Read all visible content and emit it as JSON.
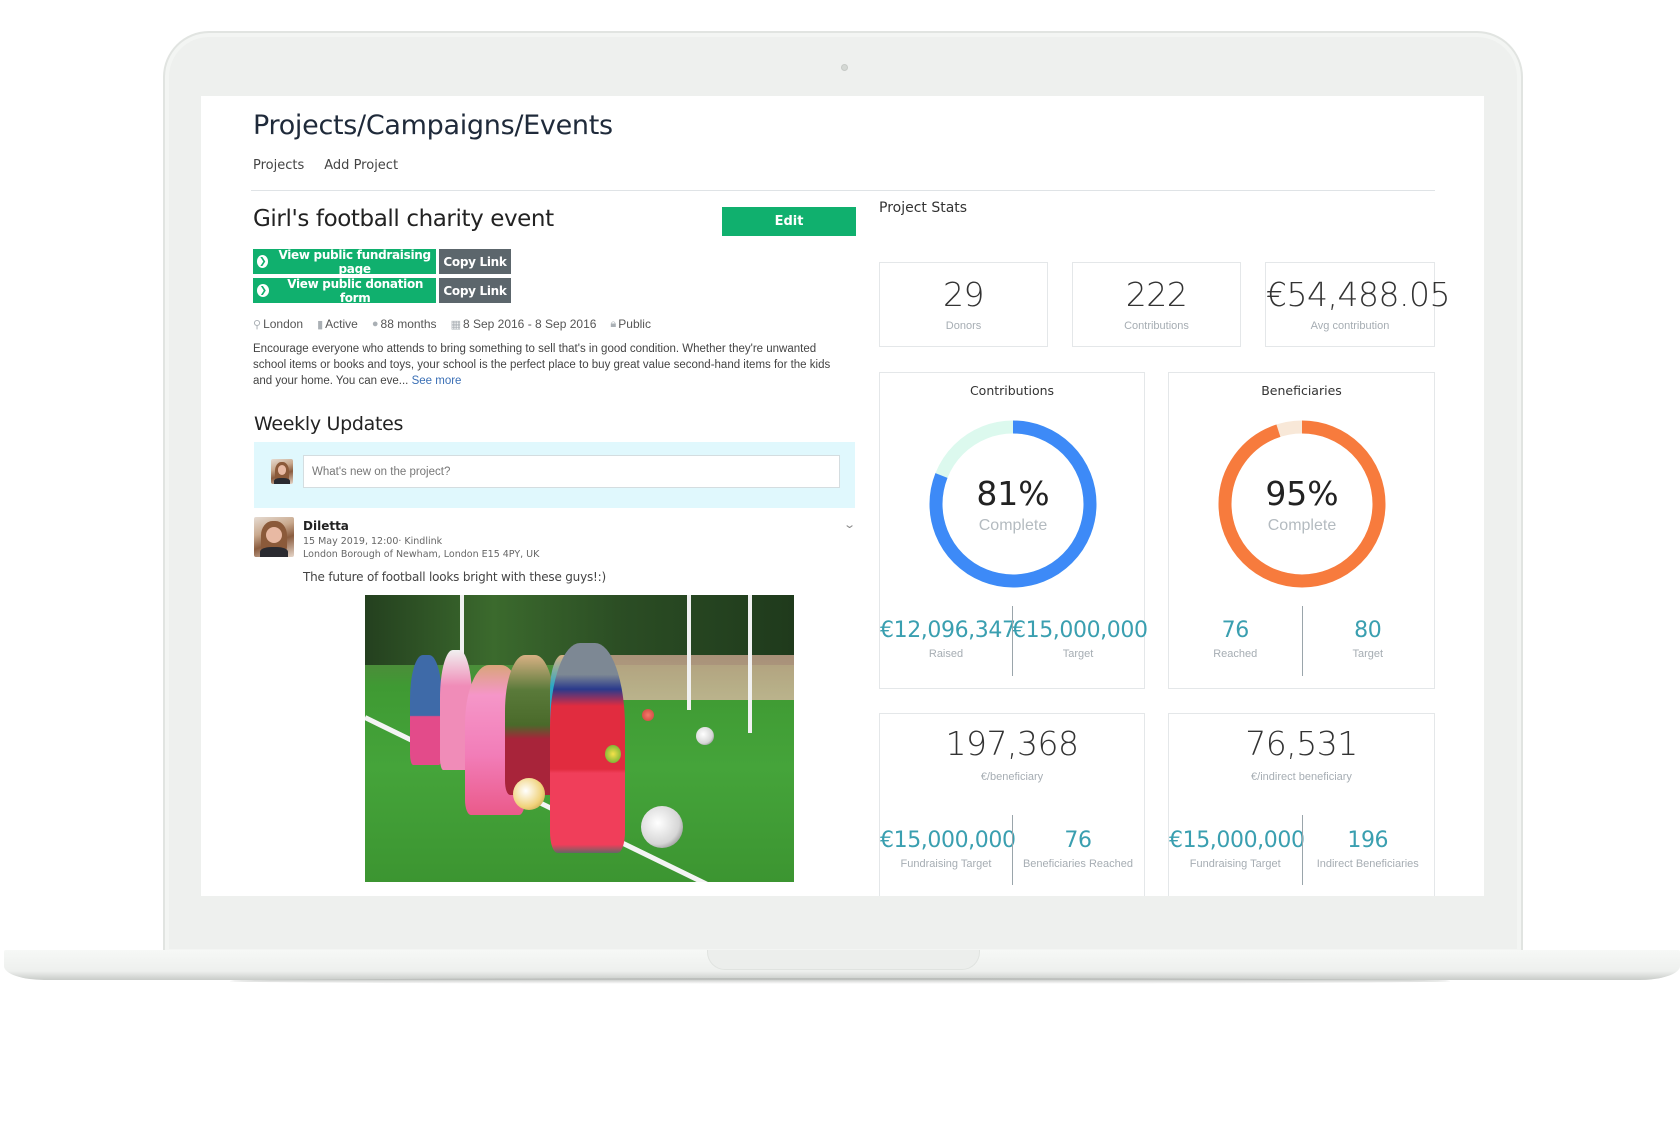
{
  "header": {
    "title": "Projects/Campaigns/Events",
    "nav": [
      {
        "label": "Projects"
      },
      {
        "label": "Add Project"
      }
    ]
  },
  "project": {
    "title": "Girl's football charity event",
    "edit_label": "Edit",
    "links": [
      {
        "label": "View public fundraising page",
        "copy_label": "Copy Link"
      },
      {
        "label": "View public donation form",
        "copy_label": "Copy Link"
      }
    ],
    "meta": {
      "location": "London",
      "status": "Active",
      "duration": "88 months",
      "dates": "8 Sep 2016 - 8 Sep 2016",
      "visibility": "Public"
    },
    "description": "Encourage everyone who attends to bring something to sell that's in good condition. Whether they're unwanted school items or books and toys, your school is the perfect place to buy great value second-hand items for the kids and your home. You can eve...",
    "see_more": "See more"
  },
  "updates": {
    "title": "Weekly Updates",
    "composer_placeholder": "What's new on the project?",
    "posts": [
      {
        "author": "Diletta",
        "timestamp": "15 May 2019, 12:00· Kindlink",
        "location": "London Borough of Newham, London E15 4PY, UK",
        "text": "The future of football looks bright with these guys!:)",
        "image_alt": "Children playing football on a green pitch"
      }
    ]
  },
  "stats": {
    "title": "Project Stats",
    "summary": [
      {
        "value": "29",
        "label": "Donors"
      },
      {
        "value": "222",
        "label": "Contributions"
      },
      {
        "value": "€54,488.05",
        "label": "Avg contribution"
      }
    ],
    "contributions": {
      "title": "Contributions",
      "percent": 81,
      "percent_label": "81%",
      "complete_label": "Complete",
      "color": "#3d8af7",
      "track_color": "#dcf9ee",
      "left": {
        "value": "€12,096,347",
        "label": "Raised"
      },
      "right": {
        "value": "€15,000,000",
        "label": "Target"
      }
    },
    "beneficiaries": {
      "title": "Beneficiaries",
      "percent": 95,
      "percent_label": "95%",
      "complete_label": "Complete",
      "color": "#f77b3d",
      "track_color": "#f8e8d8",
      "left": {
        "value": "76",
        "label": "Reached"
      },
      "right": {
        "value": "80",
        "label": "Target"
      }
    },
    "per_beneficiary": {
      "value": "197,368",
      "label": "€/beneficiary",
      "left": {
        "value": "€15,000,000",
        "label": "Fundraising Target"
      },
      "right": {
        "value": "76",
        "label": "Beneficiaries Reached"
      }
    },
    "per_indirect": {
      "value": "76,531",
      "label": "€/indirect beneficiary",
      "left": {
        "value": "€15,000,000",
        "label": "Fundraising Target"
      },
      "right": {
        "value": "196",
        "label": "Indirect Beneficiaries"
      }
    }
  },
  "colors": {
    "primary_green": "#10b06e",
    "copy_grey": "#5c666c",
    "stat_teal": "#3a9fb0",
    "composer_bg": "#e0f8fd"
  }
}
